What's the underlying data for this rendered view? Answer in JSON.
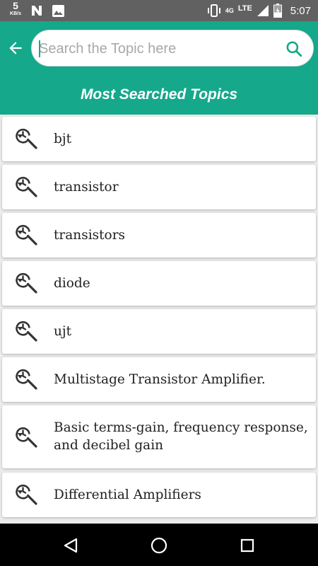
{
  "status_bar": {
    "speed_value": "5",
    "speed_unit": "KB/s",
    "network_small": "4G",
    "network_type": "LTE",
    "time": "5:07",
    "icons": [
      "n-icon",
      "image-icon",
      "vibrate-icon",
      "signal-icon",
      "battery-icon"
    ]
  },
  "header": {
    "search_placeholder": "Search the Topic here",
    "search_value": "",
    "title": "Most Searched Topics",
    "accent_color": "#15a88b"
  },
  "topics": [
    {
      "label": "bjt"
    },
    {
      "label": "transistor"
    },
    {
      "label": "transistors"
    },
    {
      "label": "diode"
    },
    {
      "label": "ujt"
    },
    {
      "label": "Multistage Transistor Amplifier."
    },
    {
      "label": "Basic terms-gain, frequency response, and decibel gain"
    },
    {
      "label": "Differential Amplifiers"
    }
  ],
  "nav_bar": {
    "icons": [
      "back-triangle-icon",
      "home-circle-icon",
      "recents-square-icon"
    ]
  }
}
